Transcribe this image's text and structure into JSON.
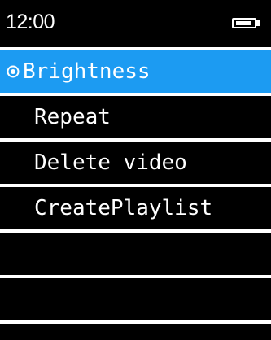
{
  "status": {
    "time": "12:00",
    "battery_icon": "battery-icon"
  },
  "menu": {
    "items": [
      {
        "label": "Brightness",
        "selected": true,
        "icon": "radio-selected-icon"
      },
      {
        "label": "Repeat",
        "selected": false
      },
      {
        "label": "Delete video",
        "selected": false
      },
      {
        "label": "CreatePlaylist",
        "selected": false
      },
      {
        "label": "",
        "selected": false
      },
      {
        "label": "",
        "selected": false
      }
    ]
  },
  "colors": {
    "background": "#000000",
    "selected_row": "#1c9bf2",
    "text": "#ffffff",
    "divider": "#ffffff"
  }
}
